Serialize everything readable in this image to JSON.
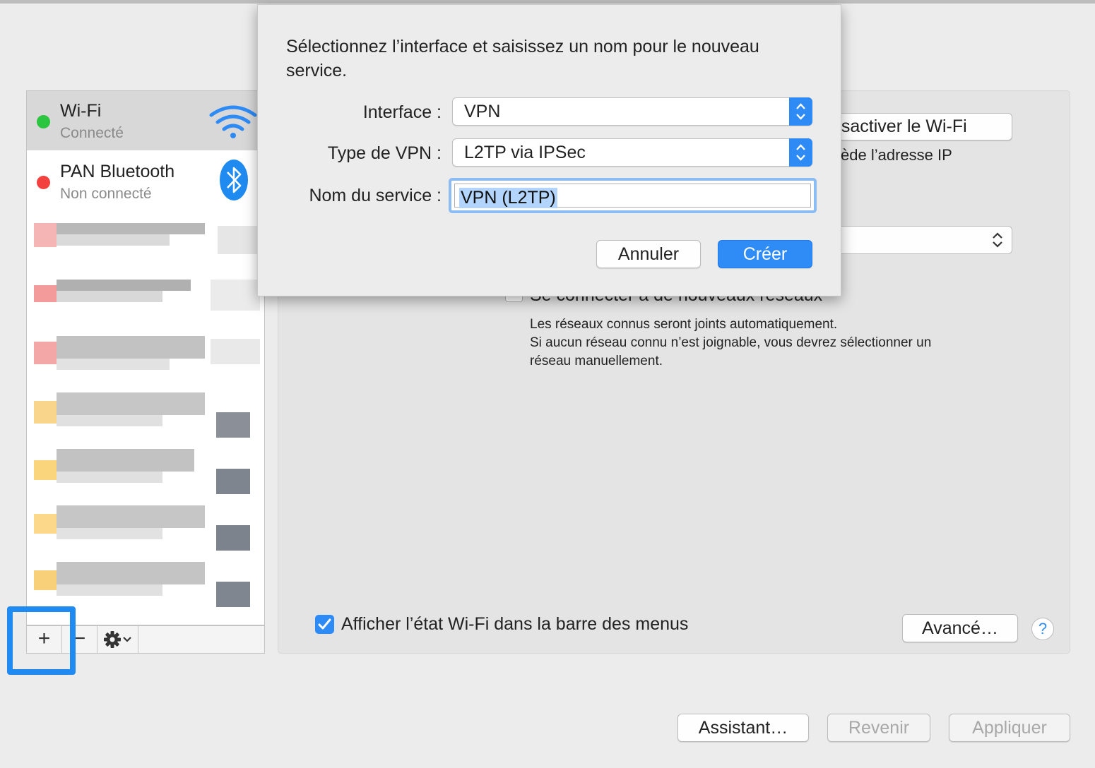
{
  "colors": {
    "accent": "#2e8bf5",
    "highlight": "#1e8af2",
    "status_green": "#2bc53f",
    "status_red": "#f2413e"
  },
  "services": [
    {
      "name": "Wi-Fi",
      "status": "Connecté",
      "icon": "wifi-icon",
      "selected": true
    },
    {
      "name": "PAN Bluetooth",
      "status": "Non connecté",
      "icon": "bluetooth-icon",
      "selected": false
    }
  ],
  "list_toolbar": {
    "add": "+",
    "remove": "−",
    "action_icon": "gear-icon"
  },
  "wifi_panel": {
    "turn_off_button": "ésactiver le Wi-Fi",
    "ip_text": "ède l’adresse IP",
    "auto_join_label": "Se connecter à de nouveaux réseaux",
    "help_line1": "Les réseaux connus seront joints automatiquement.",
    "help_line2": "Si aucun réseau connu n’est joignable, vous devrez sélectionner un",
    "help_line3": "réseau manuellement.",
    "show_status_label": "Afficher l’état Wi-Fi dans la barre des menus",
    "show_status_checked": true,
    "advanced_button": "Avancé…",
    "help_button": "?"
  },
  "footer": {
    "assistant": "Assistant…",
    "revert": "Revenir",
    "apply": "Appliquer"
  },
  "sheet": {
    "message_line1": "Sélectionnez l’interface et saisissez un nom pour le nouveau",
    "message_line2": "service.",
    "interface_label": "Interface :",
    "interface_value": "VPN",
    "vpn_type_label": "Type de VPN :",
    "vpn_type_value": "L2TP via IPSec",
    "service_name_label": "Nom du service :",
    "service_name_value": "VPN (L2TP)",
    "cancel": "Annuler",
    "create": "Créer"
  }
}
